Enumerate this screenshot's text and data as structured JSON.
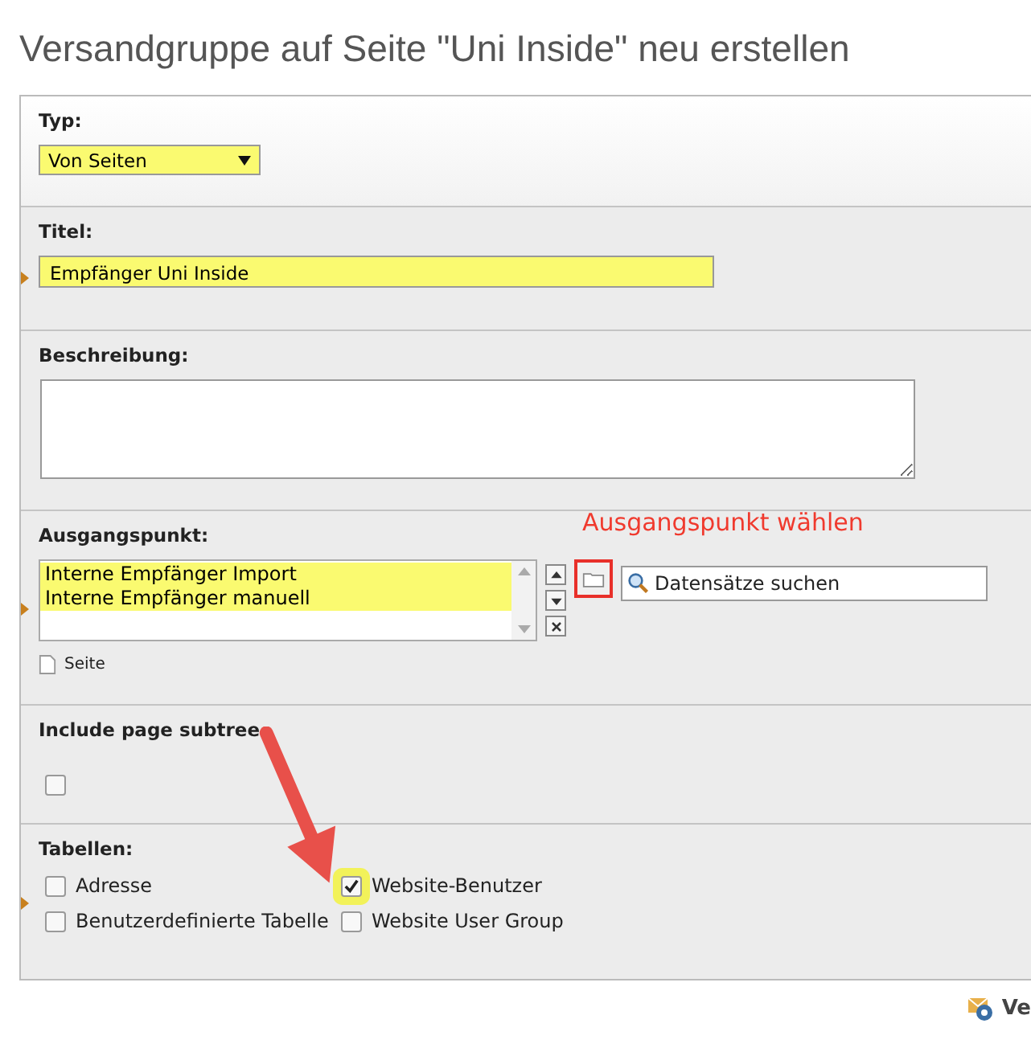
{
  "page_title": "Versandgruppe auf Seite \"Uni Inside\" neu erstellen",
  "type_field": {
    "label": "Typ:",
    "value": "Von Seiten",
    "required": false,
    "highlighted": true
  },
  "title_field": {
    "label": "Titel:",
    "value": "Empfänger Uni Inside",
    "required": true,
    "highlighted": true
  },
  "description_field": {
    "label": "Beschreibung:",
    "required": false
  },
  "start_point": {
    "label": "Ausgangspunkt:",
    "required": true,
    "items": [
      {
        "text": "Interne Empfänger Import",
        "highlighted": true
      },
      {
        "text": "Interne Empfänger manuell",
        "highlighted": true
      }
    ],
    "browse_highlighted": true,
    "annotation": "Ausgangspunkt wählen",
    "search_placeholder": "Datensätze suchen",
    "allowed_type": "Seite"
  },
  "subtree": {
    "label": "Include page subtree",
    "checked": false,
    "required": false
  },
  "tables": {
    "label": "Tabellen:",
    "required": true,
    "options": [
      {
        "label": "Adresse",
        "checked": false,
        "highlighted": false
      },
      {
        "label": "Website-Benutzer",
        "checked": true,
        "highlighted": true
      },
      {
        "label": "Benutzerdefinierte Tabelle",
        "checked": false,
        "highlighted": false
      },
      {
        "label": "Website User Group",
        "checked": false,
        "highlighted": false
      }
    ]
  },
  "footer_link": "Ve"
}
